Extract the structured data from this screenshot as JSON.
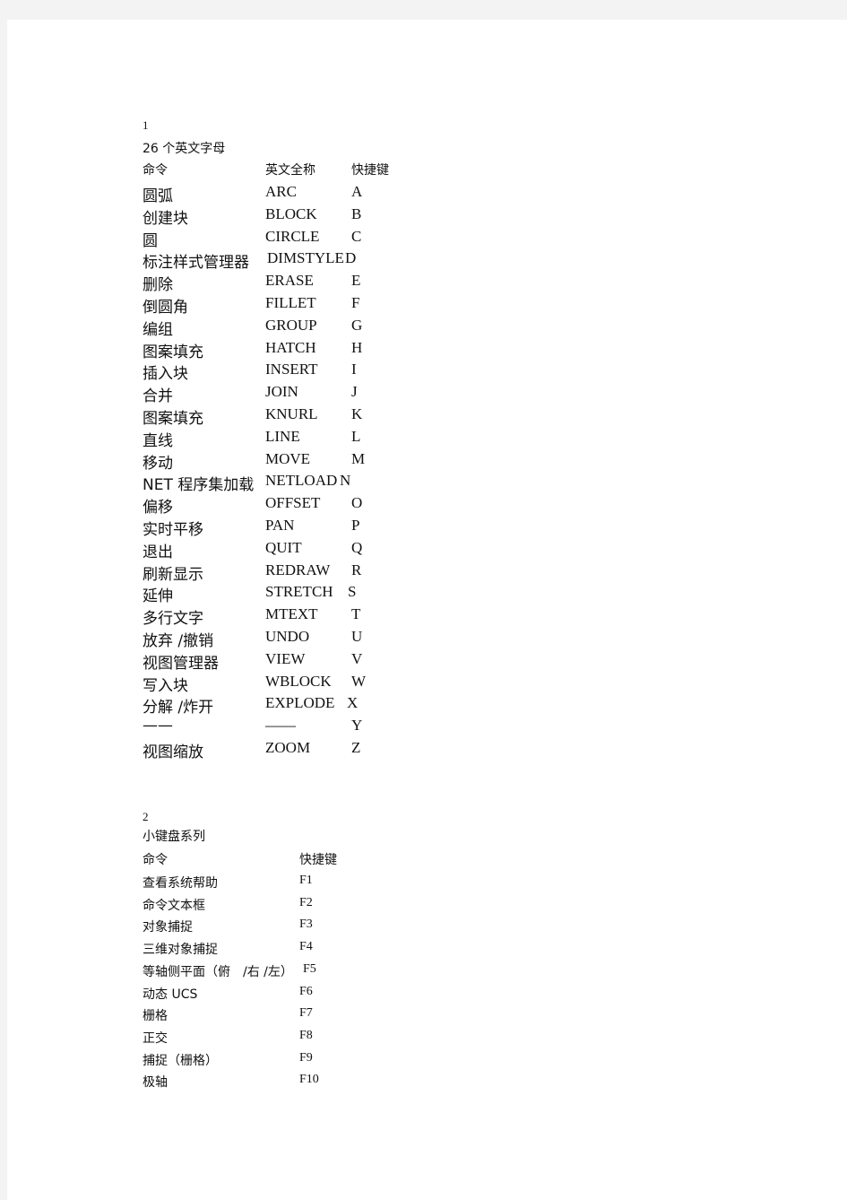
{
  "section1": {
    "number": "1",
    "title": "26 个英文字母",
    "headers": [
      "命令",
      "英文全称",
      "快捷键"
    ],
    "rows": [
      {
        "cmd": "圆弧",
        "name": "ARC",
        "key": "A"
      },
      {
        "cmd": "创建块",
        "name": "BLOCK",
        "key": "B"
      },
      {
        "cmd": "圆",
        "name": "CIRCLE",
        "key": "C"
      },
      {
        "cmd": "标注样式管理器",
        "name": "DIMSTYLE",
        "key": "D"
      },
      {
        "cmd": "删除",
        "name": "ERASE",
        "key": "E"
      },
      {
        "cmd": "倒圆角",
        "name": "FILLET",
        "key": "F"
      },
      {
        "cmd": "编组",
        "name": "GROUP",
        "key": "G"
      },
      {
        "cmd": "图案填充",
        "name": "HATCH",
        "key": "H"
      },
      {
        "cmd": "插入块",
        "name": "INSERT",
        "key": "I"
      },
      {
        "cmd": "合并",
        "name": "JOIN",
        "key": "J"
      },
      {
        "cmd": "图案填充",
        "name": "KNURL",
        "key": "K"
      },
      {
        "cmd": "直线",
        "name": "LINE",
        "key": "L"
      },
      {
        "cmd": "移动",
        "name": "MOVE",
        "key": "M"
      },
      {
        "cmd": "NET 程序集加载",
        "name": "NETLOAD",
        "key": "N"
      },
      {
        "cmd": "偏移",
        "name": "OFFSET",
        "key": "O"
      },
      {
        "cmd": "实时平移",
        "name": "PAN",
        "key": "P"
      },
      {
        "cmd": "退出",
        "name": "QUIT",
        "key": "Q"
      },
      {
        "cmd": "刷新显示",
        "name": "REDRAW",
        "key": "R"
      },
      {
        "cmd": "延伸",
        "name": "STRETCH",
        "key": "S"
      },
      {
        "cmd": "多行文字",
        "name": "MTEXT",
        "key": "T"
      },
      {
        "cmd": "放弃 /撤销",
        "name": "UNDO",
        "key": "U"
      },
      {
        "cmd": "视图管理器",
        "name": "VIEW",
        "key": "V"
      },
      {
        "cmd": "写入块",
        "name": "WBLOCK",
        "key": "W"
      },
      {
        "cmd": "分解 /炸开",
        "name": "EXPLODE",
        "key": "X"
      },
      {
        "cmd": "——",
        "name": "——",
        "key": "Y"
      },
      {
        "cmd": "视图缩放",
        "name": "ZOOM",
        "key": "Z"
      }
    ]
  },
  "section2": {
    "number": "2",
    "title": "小键盘系列",
    "headers": [
      "命令",
      "快捷键"
    ],
    "rows": [
      {
        "cmd": "查看系统帮助",
        "key": "F1"
      },
      {
        "cmd": "命令文本框",
        "key": "F2"
      },
      {
        "cmd": "对象捕捉",
        "key": "F3"
      },
      {
        "cmd": "三维对象捕捉",
        "key": "F4"
      },
      {
        "cmd": "等轴侧平面（俯　/右 /左）",
        "key": "F5"
      },
      {
        "cmd": "动态 UCS",
        "key": "F6"
      },
      {
        "cmd": "栅格",
        "key": "F7"
      },
      {
        "cmd": "正交",
        "key": "F8"
      },
      {
        "cmd": "捕捉（栅格）",
        "key": "F9"
      },
      {
        "cmd": "极轴",
        "key": "F10"
      }
    ]
  }
}
